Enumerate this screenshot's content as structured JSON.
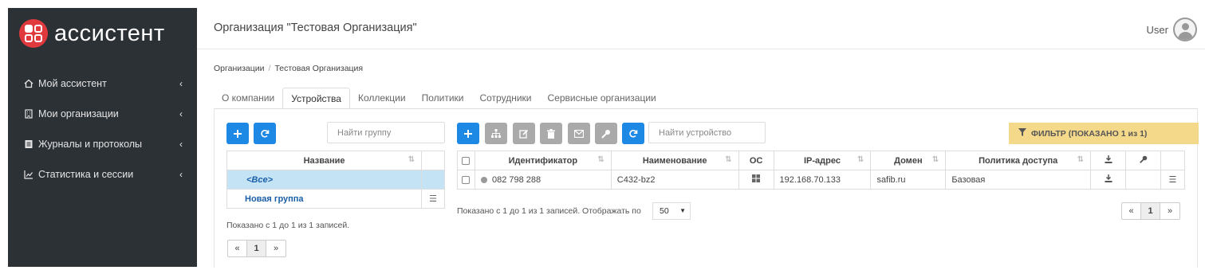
{
  "app": {
    "name": "ассистент"
  },
  "sidebar": {
    "items": [
      {
        "label": "Мой ассистент",
        "icon": "home-icon"
      },
      {
        "label": "Мои организации",
        "icon": "building-icon"
      },
      {
        "label": "Журналы и протоколы",
        "icon": "journal-icon"
      },
      {
        "label": "Статистика и сессии",
        "icon": "chart-icon"
      }
    ]
  },
  "header": {
    "title": "Организация \"Тестовая Организация\"",
    "user": "User"
  },
  "breadcrumb": {
    "root": "Организации",
    "current": "Тестовая Организация"
  },
  "tabs": [
    "О компании",
    "Устройства",
    "Коллекции",
    "Политики",
    "Сотрудники",
    "Сервисные организации"
  ],
  "groups": {
    "search_placeholder": "Найти группу",
    "column": "Название",
    "rows": [
      {
        "name": "<Все>"
      },
      {
        "name": "Новая группа"
      }
    ],
    "info": "Показано с 1 до 1 из 1 записей.",
    "page": "1"
  },
  "devices": {
    "search_placeholder": "Найти устройство",
    "filter_label": "ФИЛЬТР (ПОКАЗАНО 1 из 1)",
    "columns": [
      "Идентификатор",
      "Наименование",
      "ОС",
      "IP-адрес",
      "Домен",
      "Политика доступа"
    ],
    "rows": [
      {
        "id": "082 798 288",
        "name": "C432-bz2",
        "os": "windows",
        "ip": "192.168.70.133",
        "domain": "safib.ru",
        "policy": "Базовая"
      }
    ],
    "info": "Показано с 1 до 1 из 1 записей. Отображать по",
    "per_page": "50",
    "page": "1"
  },
  "colors": {
    "sidebar": "#2c3136",
    "accent": "#1e88e5",
    "brand": "#e03a3e",
    "filter": "#f5d98b",
    "selected": "#c4e3f5"
  }
}
